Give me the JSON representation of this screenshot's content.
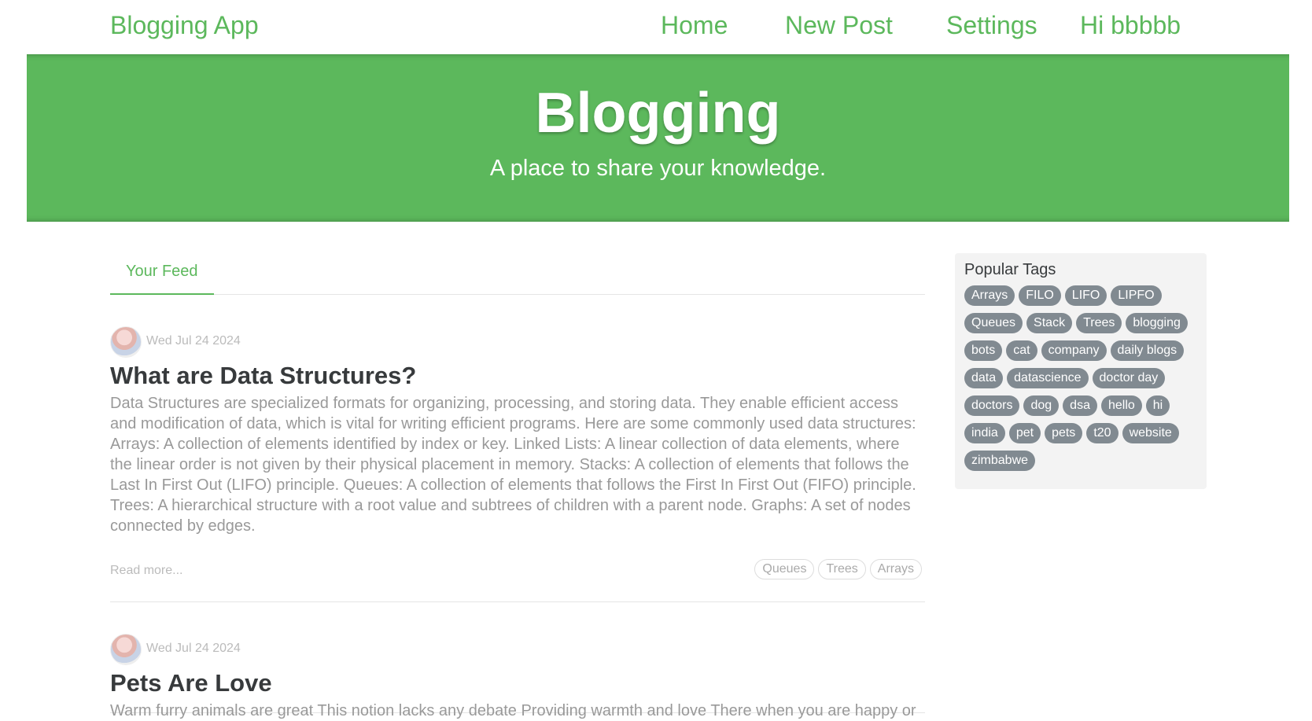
{
  "navbar": {
    "brand": "Blogging App",
    "links": [
      "Home",
      "New Post",
      "Settings",
      "Hi bbbbb"
    ]
  },
  "banner": {
    "title": "Blogging",
    "subtitle": "A place to share your knowledge."
  },
  "feed": {
    "tab": "Your Feed",
    "articles": [
      {
        "date": "Wed Jul 24 2024",
        "title": "What are Data Structures?",
        "description": "Data Structures are specialized formats for organizing, processing, and storing data. They enable efficient access and modification of data, which is vital for writing efficient programs. Here are some commonly used data structures: Arrays: A collection of elements identified by index or key. Linked Lists: A linear collection of data elements, where the linear order is not given by their physical placement in memory. Stacks: A collection of elements that follows the Last In First Out (LIFO) principle. Queues: A collection of elements that follows the First In First Out (FIFO) principle. Trees: A hierarchical structure with a root value and subtrees of children with a parent node. Graphs: A set of nodes connected by edges.",
        "read_more": "Read more...",
        "tags": [
          "Queues",
          "Trees",
          "Arrays"
        ]
      },
      {
        "date": "Wed Jul 24 2024",
        "title": "Pets Are Love",
        "description": "Warm furry animals are great This notion lacks any debate Providing warmth and love There when you are happy or"
      }
    ]
  },
  "sidebar": {
    "title": "Popular Tags",
    "tags": [
      "Arrays",
      "FILO",
      "LIFO",
      "LIPFO",
      "Queues",
      "Stack",
      "Trees",
      "blogging",
      "bots",
      "cat",
      "company",
      "daily blogs",
      "data",
      "datascience",
      "doctor day",
      "doctors",
      "dog",
      "dsa",
      "hello",
      "hi",
      "india",
      "pet",
      "pets",
      "t20",
      "website",
      "zimbabwe"
    ]
  },
  "colors": {
    "brand": "#5cb85c",
    "tag_pill": "#818a91",
    "sidebar_bg": "#f3f3f3"
  }
}
